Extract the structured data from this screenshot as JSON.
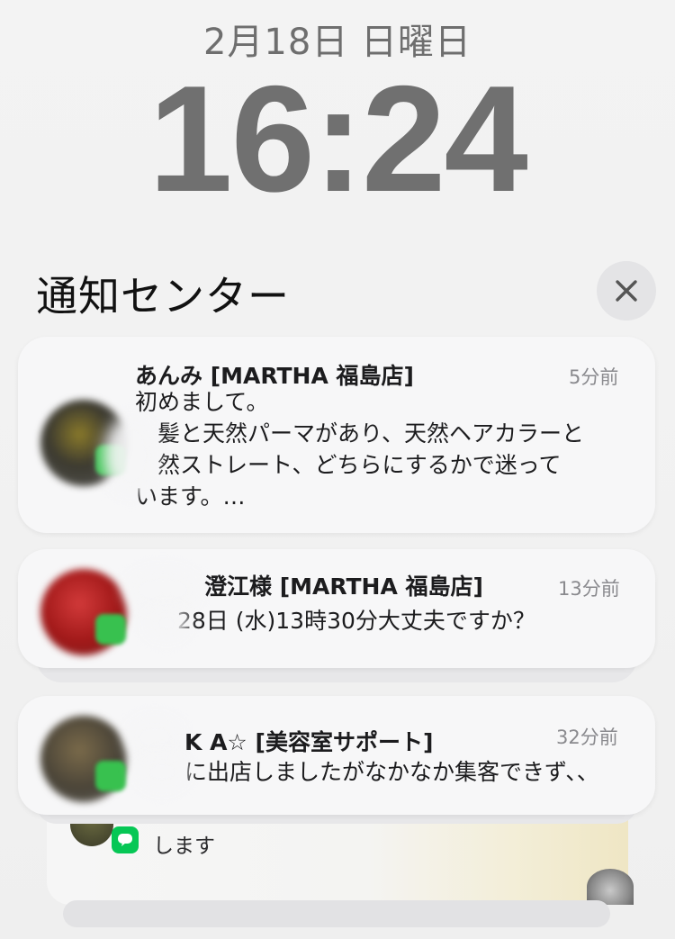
{
  "lockscreen": {
    "date": "2月18日 日曜日",
    "time": "16:24"
  },
  "notification_center": {
    "title": "通知センター",
    "clear_icon": "close-icon"
  },
  "notifications": [
    {
      "title": "あんみ [MARTHA 福島店]",
      "time": "5分前",
      "body": "初めまして。\n　髪と天然パーマがあり、天然ヘアカラーと\n　然ストレート、どちらにするかで迷って\nいます。…",
      "app_icon": "line-icon"
    },
    {
      "title": "澄江様 [MARTHA 福島店]",
      "time": "13分前",
      "body": "28日 (水)13時30分大丈夫ですか？",
      "app_icon": "line-icon"
    },
    {
      "title": "K A☆ [美容室サポート]",
      "time": "32分前",
      "body": "に出店しましたがなかなか集客できず、、",
      "app_icon": "line-icon"
    }
  ],
  "stacked_preview": {
    "body": "します",
    "app_icon": "line-icon"
  },
  "colors": {
    "line_green": "#06c755",
    "clock_gray": "#707070"
  }
}
